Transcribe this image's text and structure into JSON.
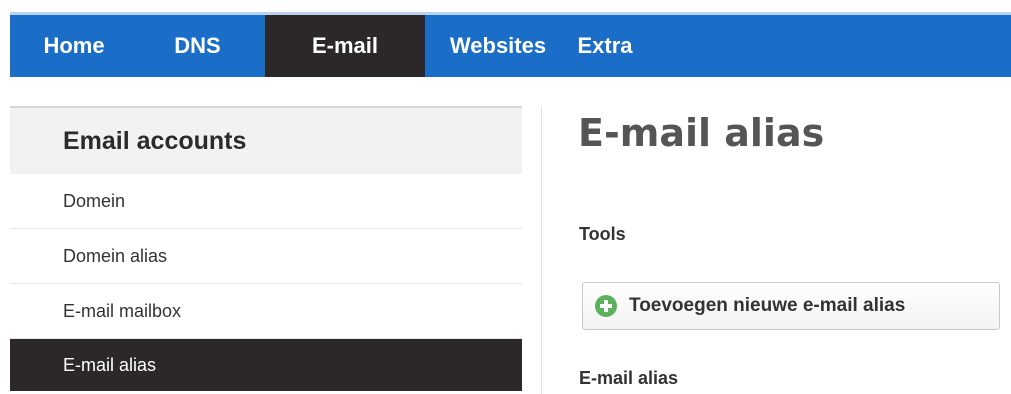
{
  "nav": {
    "items": [
      {
        "label": "Home",
        "active": false
      },
      {
        "label": "DNS",
        "active": false
      },
      {
        "label": "E-mail",
        "active": true
      },
      {
        "label": "Websites",
        "active": false
      },
      {
        "label": "Extra",
        "active": false
      }
    ]
  },
  "sidebar": {
    "heading": "Email accounts",
    "items": [
      {
        "label": "Domein",
        "active": false
      },
      {
        "label": "Domein alias",
        "active": false
      },
      {
        "label": "E-mail mailbox",
        "active": false
      },
      {
        "label": "E-mail alias",
        "active": true
      }
    ]
  },
  "main": {
    "title": "E-mail alias",
    "tools_heading": "Tools",
    "add_button_label": "Toevoegen nieuwe e-mail alias",
    "add_button_icon": "plus-circle-icon",
    "list_heading": "E-mail alias"
  },
  "colors": {
    "nav_bg": "#1a6ec8",
    "active_bg": "#2c2829",
    "sidebar_head_bg": "#f2f2f2",
    "add_icon": "#5bb25b"
  }
}
